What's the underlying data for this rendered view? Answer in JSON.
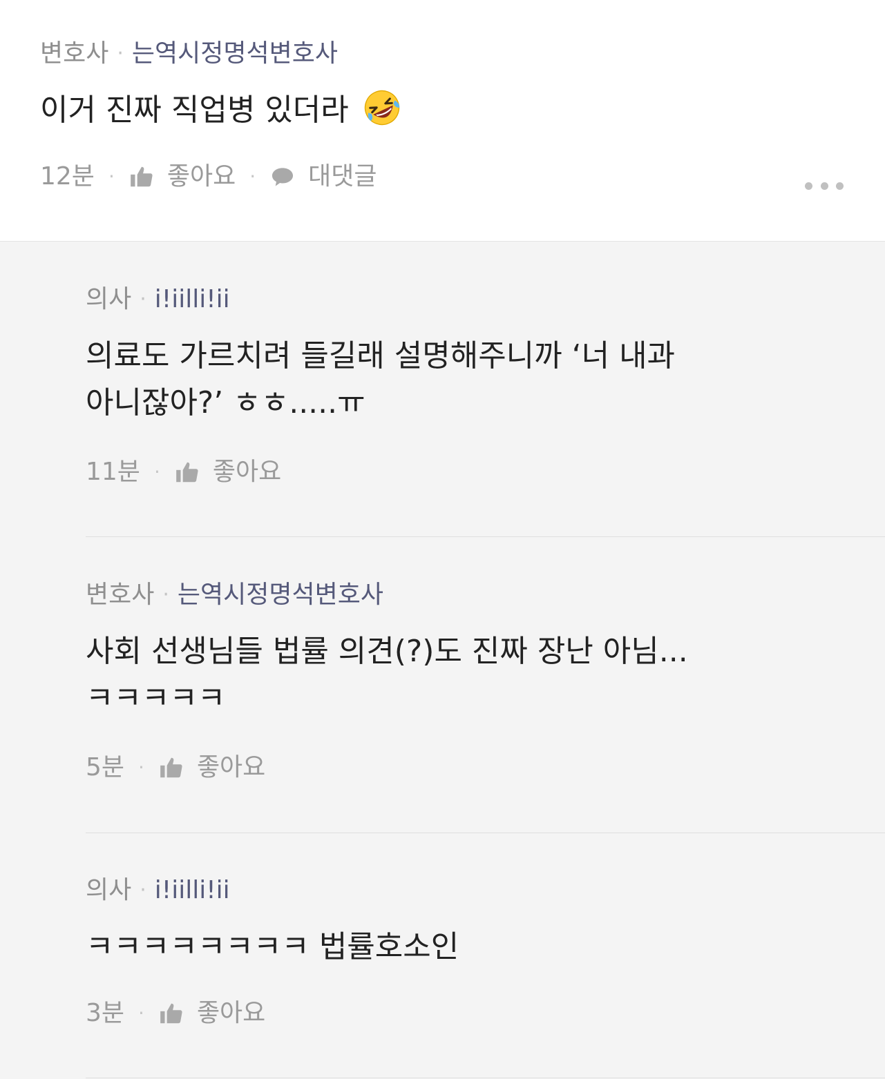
{
  "comments": [
    {
      "role": "변호사",
      "name": "는역시정명석변호사",
      "text": "이거 진짜 직업병 있더라",
      "emoji": "rolling-on-floor-laughing-emoji",
      "time": "12분",
      "like_label": "좋아요",
      "reply_label": "대댓글"
    }
  ],
  "replies": [
    {
      "role": "의사",
      "name": "i!iilli!ii",
      "text_line1": "의료도 가르치려 들길래 설명해주니까 ‘너 내과",
      "text_line2": "아니잖아?’ ㅎㅎ.....ㅠ",
      "time": "11분",
      "like_label": "좋아요"
    },
    {
      "role": "변호사",
      "name": "는역시정명석변호사",
      "text_line1": "사회 선생님들 법률 의견(?)도 진짜 장난 아님...",
      "text_line2": "ㅋㅋㅋㅋㅋ",
      "time": "5분",
      "like_label": "좋아요"
    },
    {
      "role": "의사",
      "name": "i!iilli!ii",
      "text_line1": "ㅋㅋㅋㅋㅋㅋㅋㅋ 법률호소인",
      "time": "3분",
      "like_label": "좋아요"
    }
  ],
  "icons": {
    "like": "thumbs-up-icon",
    "reply": "speech-bubble-icon",
    "more": "more-dots-icon"
  },
  "colors": {
    "background_top": "#ffffff",
    "background_replies": "#f4f4f4",
    "author_role": "#8f8f8f",
    "author_name": "#55597a",
    "meta_text": "#9a9a9a",
    "body_text": "#222222"
  },
  "separator_dot": "·"
}
